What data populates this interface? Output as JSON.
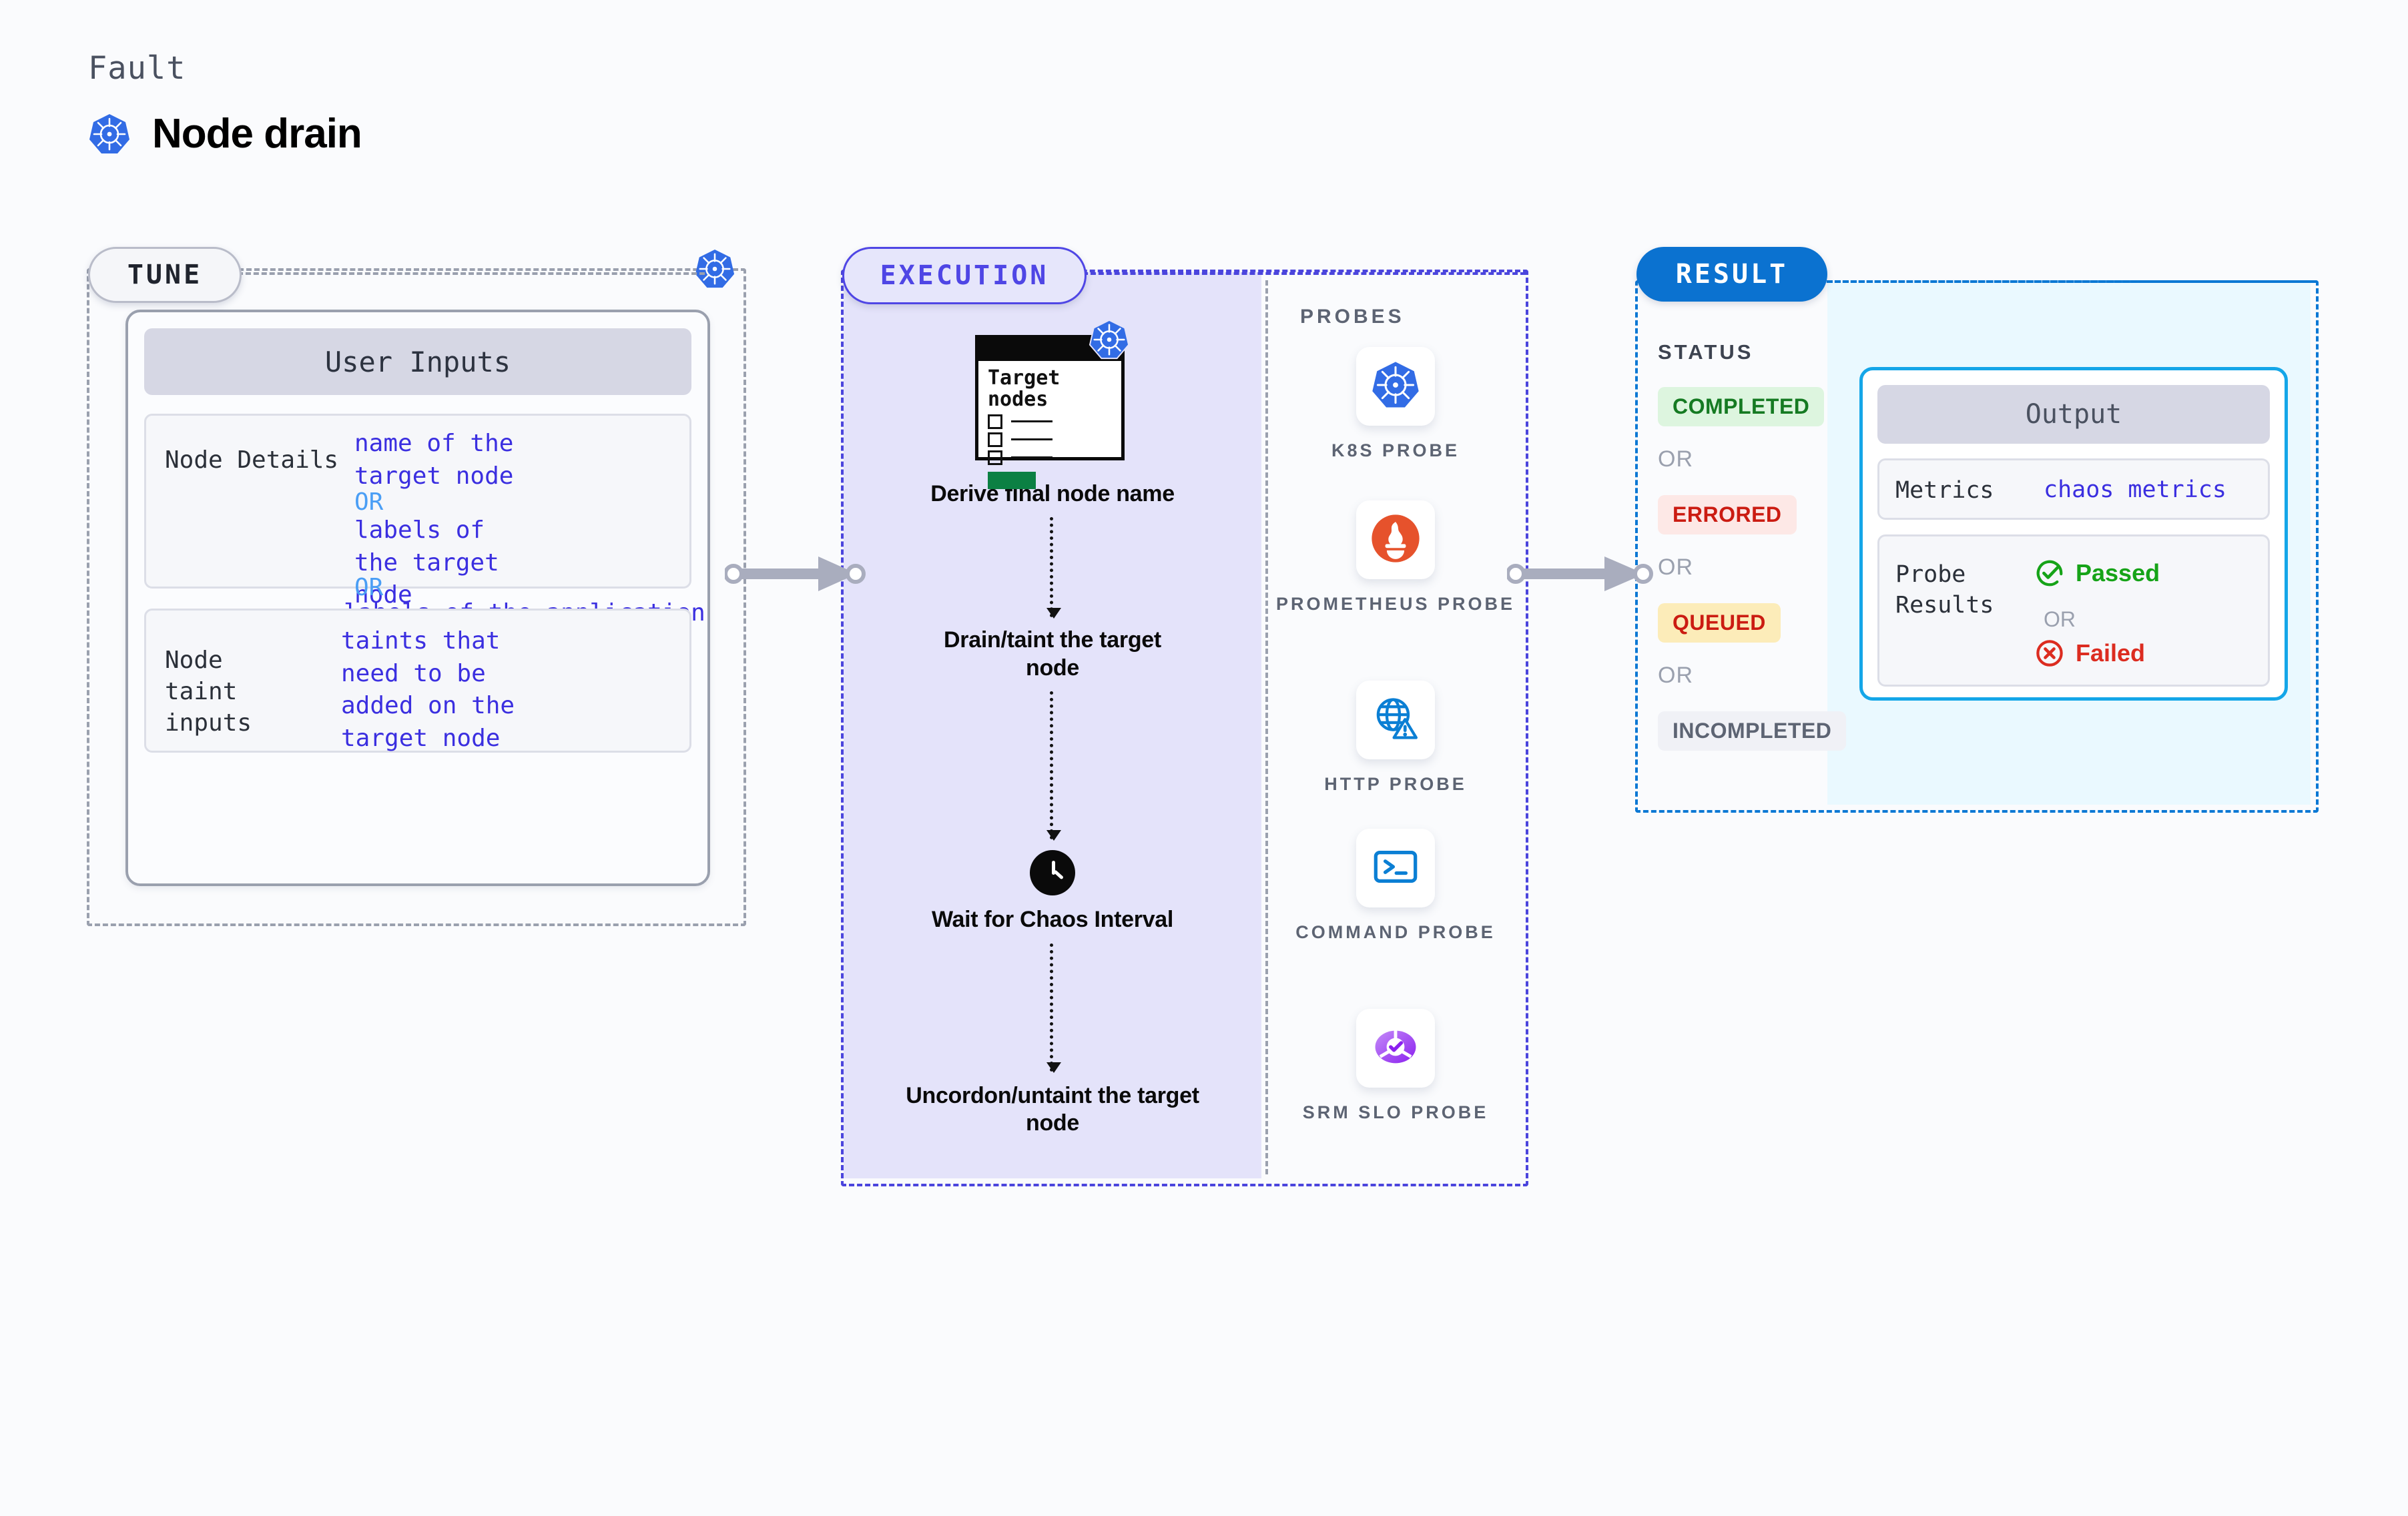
{
  "header": {
    "eyebrow": "Fault",
    "title": "Node drain",
    "icon": "kubernetes-icon"
  },
  "tune": {
    "badge": "TUNE",
    "corner_icon": "kubernetes-icon",
    "card_header": "User Inputs",
    "rows": [
      {
        "key": "Node Details",
        "values": [
          {
            "text": "name of the target node",
            "style": "primary"
          },
          {
            "text": "OR",
            "style": "or"
          },
          {
            "text": "labels of the target node",
            "style": "primary"
          },
          {
            "text": "OR",
            "style": "or"
          },
          {
            "text": "labels of the application scheduled on target node",
            "style": "primary"
          }
        ]
      },
      {
        "key": "Node taint inputs",
        "values": [
          {
            "text": "taints that need to be added on the target node",
            "style": "primary"
          }
        ]
      }
    ]
  },
  "execution": {
    "badge": "EXECUTION",
    "target_card": {
      "title_line1": "Target",
      "title_line2": "nodes",
      "icon": "kubernetes-icon",
      "checkbox_count": 3,
      "progress_bar_color": "#0b8043"
    },
    "steps": [
      {
        "label": "Derive final node name",
        "icon": "target-nodes-card"
      },
      {
        "label": "Drain/taint the target node",
        "icon": "none"
      },
      {
        "label": "Wait for Chaos Interval",
        "icon": "clock-icon"
      },
      {
        "label": "Uncordon/untaint the target node",
        "icon": "none"
      }
    ],
    "probes_title": "PROBES",
    "probes": [
      {
        "label": "K8S PROBE",
        "icon": "kubernetes-icon"
      },
      {
        "label": "PROMETHEUS PROBE",
        "icon": "prometheus-icon"
      },
      {
        "label": "HTTP PROBE",
        "icon": "globe-warning-icon"
      },
      {
        "label": "COMMAND PROBE",
        "icon": "terminal-icon"
      },
      {
        "label": "SRM SLO PROBE",
        "icon": "srm-slo-icon"
      }
    ]
  },
  "result": {
    "badge": "RESULT",
    "status_title": "STATUS",
    "or_label": "OR",
    "statuses": [
      {
        "label": "COMPLETED",
        "variant": "completed"
      },
      {
        "label": "ERRORED",
        "variant": "errored"
      },
      {
        "label": "QUEUED",
        "variant": "queued"
      },
      {
        "label": "INCOMPLETED",
        "variant": "incompleted"
      }
    ],
    "output": {
      "header": "Output",
      "metrics_key": "Metrics",
      "metrics_value": "chaos metrics",
      "probe_results_key_line1": "Probe",
      "probe_results_key_line2": "Results",
      "passed_label": "Passed",
      "failed_label": "Failed",
      "or_label": "OR"
    }
  },
  "colors": {
    "canvas": "#fafbfd",
    "tune_dash": "#9aa0ae",
    "execution_dash": "#4b45dd",
    "execution_fill": "#e4e3fa",
    "result_dash": "#0b78d4",
    "result_fill": "#eaf9ff",
    "result_badge": "#0b72d0",
    "output_border": "#14a6e8",
    "value_text": "#3b2fe0",
    "or_text": "#4a9ef5",
    "kubernetes_blue": "#326ce5",
    "prometheus_orange": "#e6522c",
    "passed_green": "#16a318",
    "failed_red": "#dc2c20"
  }
}
